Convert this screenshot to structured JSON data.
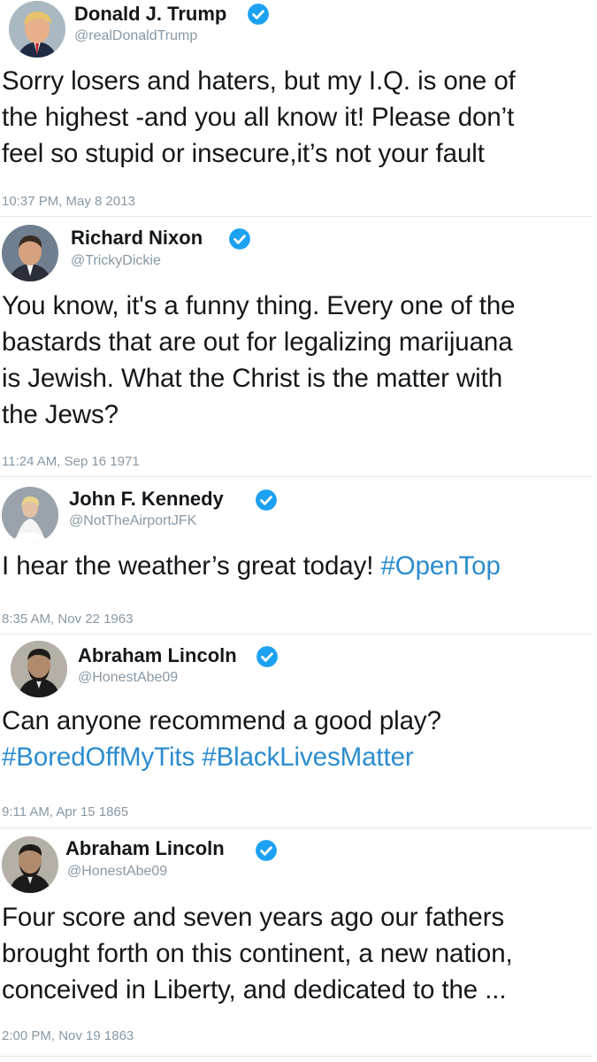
{
  "colors": {
    "text": "#14171a",
    "muted": "#8899a6",
    "hashtag": "#2b8ccf",
    "verified_badge": "#1da1f2",
    "separator": "#e1e8ed"
  },
  "tweets": [
    {
      "name": "Donald J. Trump",
      "handle": "@realDonaldTrump",
      "verified": true,
      "text": "Sorry losers and haters, but my I.Q. is one of\nthe highest -and you all know it! Please don’t\nfeel so stupid or insecure,it’s not your fault",
      "timestamp": "10:37 PM, May 8 2013"
    },
    {
      "name": "Richard Nixon",
      "handle": "@TrickyDickie",
      "verified": true,
      "text": "You know, it's a funny thing. Every one of the\nbastards that are out for legalizing marijuana\nis Jewish. What the Christ is the matter with\nthe Jews?",
      "timestamp": "11:24 AM, Sep 16 1971"
    },
    {
      "name": "John F. Kennedy",
      "handle": "@NotTheAirportJFK",
      "verified": true,
      "text": "I hear the weather’s great today! ",
      "hashtags": [
        "#OpenTop"
      ],
      "timestamp": "8:35 AM, Nov 22 1963"
    },
    {
      "name": "Abraham Lincoln",
      "handle": "@HonestAbe09",
      "verified": true,
      "text": "Can anyone recommend a good play?\n",
      "hashtags": [
        "#BoredOffMyTits",
        " #BlackLivesMatter"
      ],
      "timestamp": "9:11 AM, Apr 15 1865"
    },
    {
      "name": "Abraham Lincoln",
      "handle": "@HonestAbe09",
      "verified": true,
      "text": "Four score and seven years ago our fathers\nbrought forth on this continent, a new nation,\nconceived in Liberty, and dedicated to the ...",
      "timestamp": "2:00 PM, Nov 19 1863"
    }
  ]
}
